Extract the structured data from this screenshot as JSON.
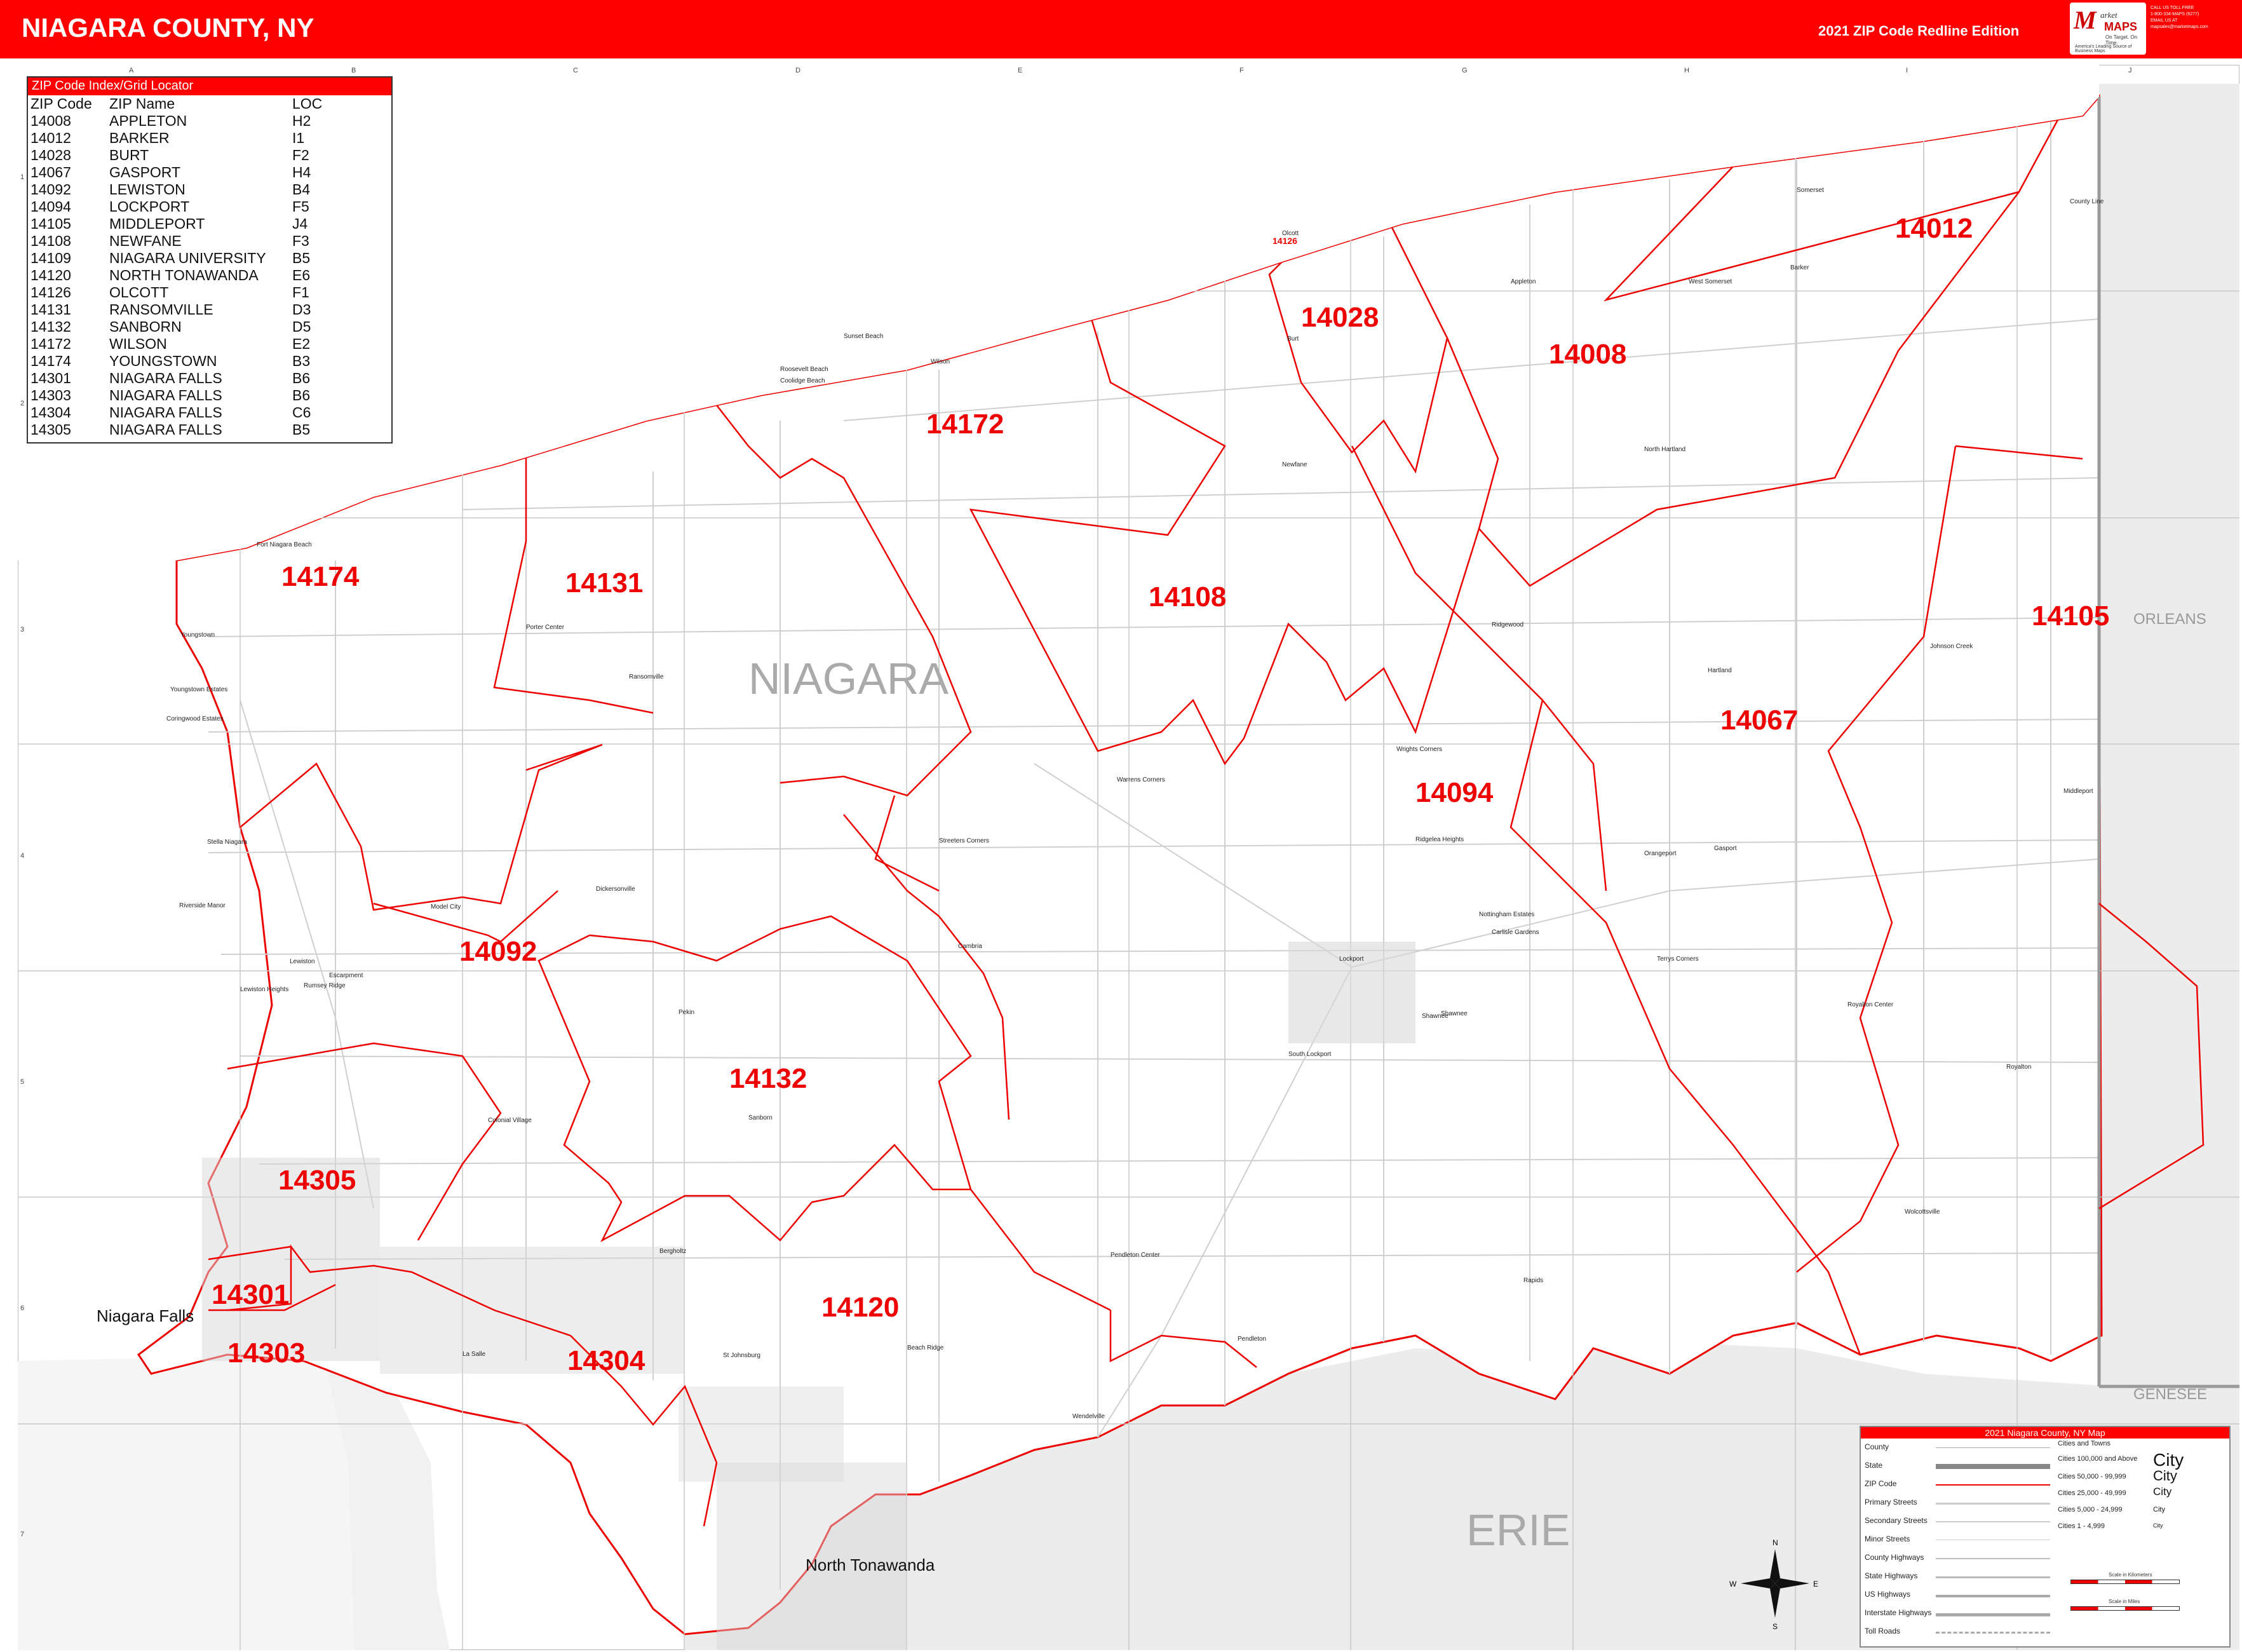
{
  "header": {
    "title": "NIAGARA COUNTY, NY",
    "edition": "2021 ZIP Code Redline Edition",
    "logo_text": "arket",
    "logo_maps": "MAPS",
    "logo_tag": "On Target. On Time.",
    "logo_sub": "America's Leading Source of Business Maps",
    "contact": [
      "CALL US TOLL FREE",
      "1-800-334-MAPS (6277)",
      "EMAIL US AT",
      "mapsales@marketmaps.com"
    ]
  },
  "colors": {
    "header": "#ff0000",
    "zip_boundary": "#ee0000",
    "county_line": "#999999",
    "roads": "#cfcfcf",
    "land_outside": "#ececec",
    "water": "#ffffff"
  },
  "grid": {
    "columns": [
      "A",
      "B",
      "C",
      "D",
      "E",
      "F",
      "G",
      "H",
      "I",
      "J"
    ],
    "rows": [
      "1",
      "2",
      "3",
      "4",
      "5",
      "6",
      "7"
    ]
  },
  "index": {
    "title": "ZIP Code Index/Grid Locator",
    "headers": [
      "ZIP Code",
      "ZIP Name",
      "LOC"
    ],
    "rows": [
      [
        "14008",
        "APPLETON",
        "H2"
      ],
      [
        "14012",
        "BARKER",
        "I1"
      ],
      [
        "14028",
        "BURT",
        "F2"
      ],
      [
        "14067",
        "GASPORT",
        "H4"
      ],
      [
        "14092",
        "LEWISTON",
        "B4"
      ],
      [
        "14094",
        "LOCKPORT",
        "F5"
      ],
      [
        "14105",
        "MIDDLEPORT",
        "J4"
      ],
      [
        "14108",
        "NEWFANE",
        "F3"
      ],
      [
        "14109",
        "NIAGARA UNIVERSITY",
        "B5"
      ],
      [
        "14120",
        "NORTH TONAWANDA",
        "E6"
      ],
      [
        "14126",
        "OLCOTT",
        "F1"
      ],
      [
        "14131",
        "RANSOMVILLE",
        "D3"
      ],
      [
        "14132",
        "SANBORN",
        "D5"
      ],
      [
        "14172",
        "WILSON",
        "E2"
      ],
      [
        "14174",
        "YOUNGSTOWN",
        "B3"
      ],
      [
        "14301",
        "NIAGARA FALLS",
        "B6"
      ],
      [
        "14303",
        "NIAGARA FALLS",
        "B6"
      ],
      [
        "14304",
        "NIAGARA FALLS",
        "C6"
      ],
      [
        "14305",
        "NIAGARA FALLS",
        "B5"
      ]
    ]
  },
  "counties": {
    "main": "NIAGARA",
    "south": "ERIE",
    "east": "ORLEANS",
    "southeast": "GENESEE"
  },
  "zip_labels": [
    "14012",
    "14028",
    "14008",
    "14172",
    "14174",
    "14131",
    "14108",
    "14105",
    "14067",
    "14094",
    "14092",
    "14132",
    "14305",
    "14120",
    "14301",
    "14304",
    "14303",
    "14126"
  ],
  "big_places": [
    "Niagara Falls",
    "North Tonawanda"
  ],
  "places": [
    "Fort Niagara Beach",
    "Youngstown",
    "Youngstown Estates",
    "Coringwood Estates",
    "Stella Niagara",
    "Riverside Manor",
    "Lewiston",
    "Escarpment",
    "Lewiston Heights",
    "Rumsey Ridge",
    "Model City",
    "Porter Center",
    "Ransomville",
    "Dickersonville",
    "Pekin",
    "Sanborn",
    "Colonial Village",
    "Cambria",
    "Streeters Corners",
    "Warrens Corners",
    "Wilson",
    "Sunset Beach",
    "Roosevelt Beach",
    "Coolidge Beach",
    "Olcott",
    "Burt",
    "Newfane",
    "Appleton",
    "West Somerset",
    "Somerset",
    "Barker",
    "North Hartland",
    "Ridgewood",
    "Wrights Corners",
    "Ridgelea Heights",
    "Lockport",
    "South Lockport",
    "Shawnee",
    "Nottingham Estates",
    "Carlisle Gardens",
    "Orangeport",
    "Gasport",
    "Hartland",
    "Johnson Creek",
    "Middleport",
    "Terrys Corners",
    "Royalton Center",
    "Royalton",
    "Wolcottsville",
    "Pendleton Center",
    "Pendleton",
    "Rapids",
    "Bergholtz",
    "St Johnsburg",
    "Beach Ridge",
    "Wendelville",
    "Shawnee",
    "La Salle",
    "County Line"
  ],
  "legend": {
    "title": "2021 Niagara County, NY Map",
    "items": [
      "County",
      "State",
      "ZIP Code",
      "Primary Streets",
      "Secondary Streets",
      "Minor Streets",
      "County Highways",
      "State Highways",
      "US Highways",
      "Interstate Highways",
      "Toll Roads"
    ],
    "cities_header": "Cities and Towns",
    "cities": [
      "Cities 100,000 and Above",
      "Cities 50,000 - 99,999",
      "Cities 25,000 - 49,999",
      "Cities 5,000 - 24,999",
      "Cities 1 - 4,999"
    ],
    "city_word": "City",
    "scale_km": "Scale in Kilometers",
    "scale_mi": "Scale in Miles"
  },
  "compass": {
    "n": "N",
    "s": "S",
    "e": "E",
    "w": "W"
  }
}
